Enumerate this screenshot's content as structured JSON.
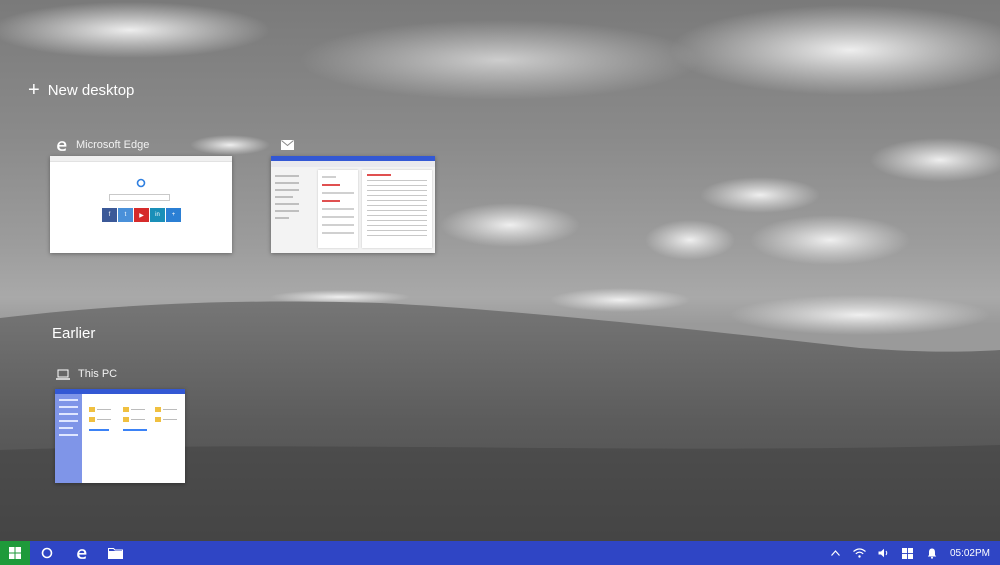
{
  "task_view": {
    "new_desktop_label": "New desktop",
    "earlier_heading": "Earlier",
    "windows": [
      {
        "app": "Microsoft Edge",
        "icon": "edge-icon"
      },
      {
        "app": "",
        "icon": "mail-icon"
      }
    ],
    "earlier_windows": [
      {
        "app": "This PC",
        "icon": "laptop-icon"
      }
    ]
  },
  "taskbar": {
    "pinned": [
      "windows-logo-icon",
      "cortana-icon",
      "edge-icon",
      "file-explorer-icon"
    ],
    "tray_icons": [
      "chevron-up-icon",
      "wifi-icon",
      "volume-icon",
      "windows-logo-icon",
      "notification-icon"
    ],
    "clock": "05:02PM"
  },
  "colors": {
    "taskbar": "#2f45c5",
    "start": "#1e9a3a",
    "accent_blue": "#3358d4"
  }
}
